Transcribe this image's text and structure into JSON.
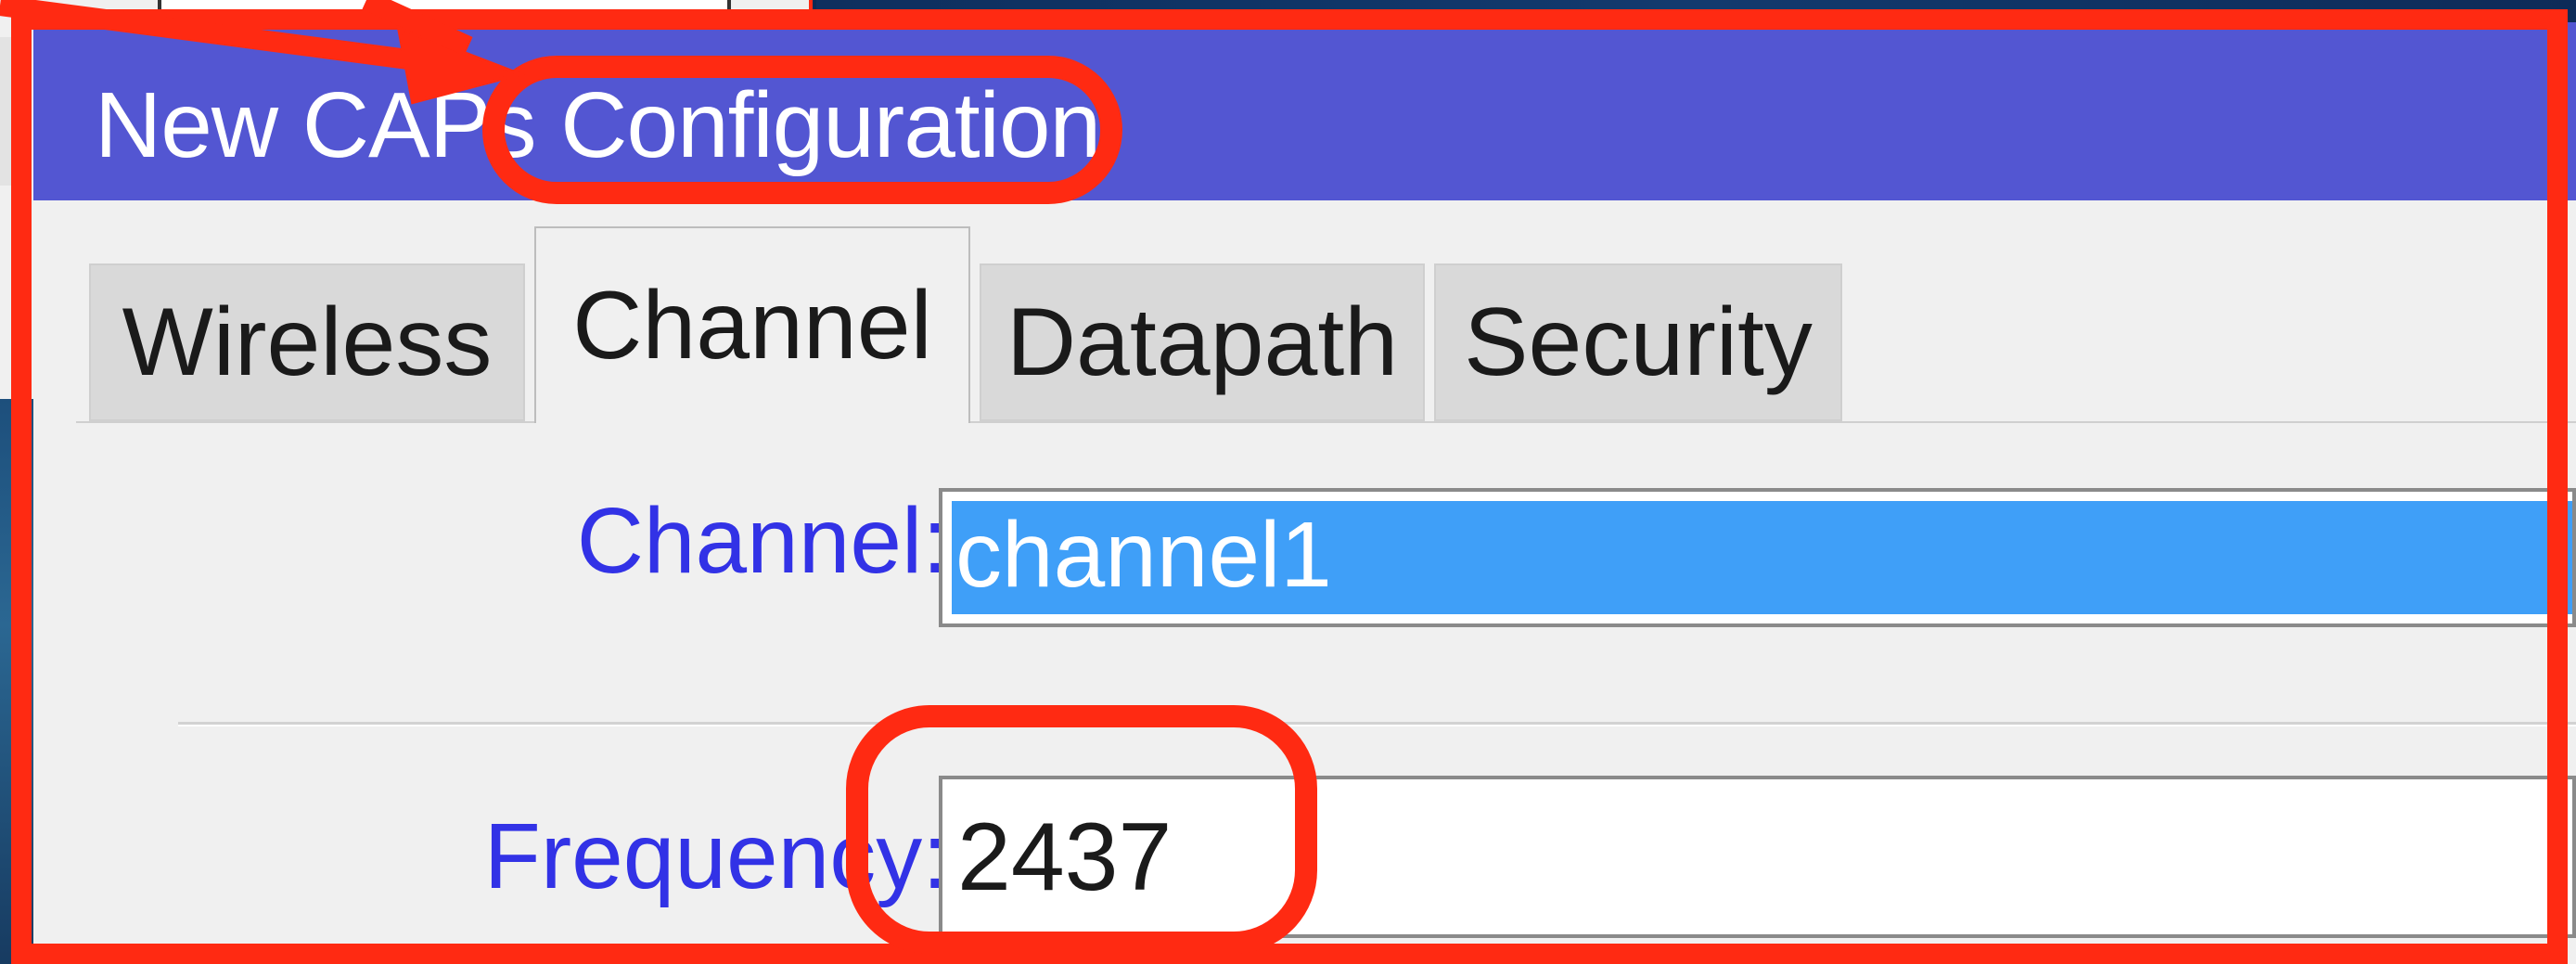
{
  "dialog": {
    "title": "New CAPs Configuration"
  },
  "tabs": [
    {
      "label": "Wireless",
      "active": false
    },
    {
      "label": "Channel",
      "active": true
    },
    {
      "label": "Datapath",
      "active": false
    },
    {
      "label": "Security",
      "active": false
    }
  ],
  "channel_tab": {
    "channel_label": "Channel:",
    "channel_value": "channel1",
    "frequency_label": "Frequency:",
    "frequency_value": "2437"
  },
  "colors": {
    "title_bar": "#5356d2",
    "annotation": "#ff2a12",
    "label_text": "#3232e6",
    "selection": "#3f9ff8"
  }
}
